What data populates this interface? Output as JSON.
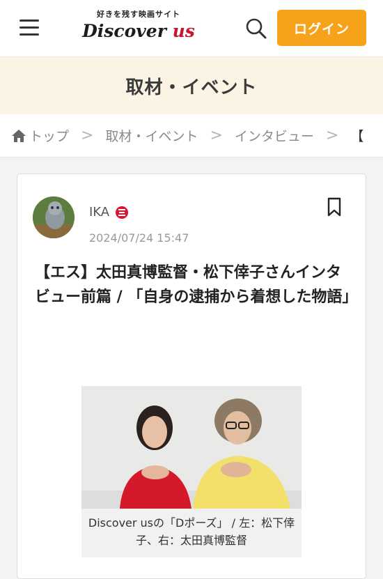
{
  "header": {
    "tagline": "好きを残す映画サイト",
    "logo_main": "Discover ",
    "logo_accent": "us",
    "login_label": "ログイン"
  },
  "banner": {
    "title": "取材・イベント"
  },
  "breadcrumb": {
    "items": [
      "トップ",
      "取材・イベント",
      "インタビュー",
      "【"
    ],
    "separator": ">"
  },
  "article": {
    "author": "IKA",
    "date": "2024/07/24 15:47",
    "title": "【エス】太田真博監督・松下倖子さんインタビュー前篇 / 「自身の逮捕から着想した物語」",
    "caption": "Discover usの「Dポーズ」 / 左：松下倖子、右：太田真博監督"
  },
  "colors": {
    "accent": "#f7a21b",
    "banner_bg": "#fbf3e3",
    "logo_red": "#c9142e"
  },
  "icons": {
    "menu": "hamburger-menu-icon",
    "search": "search-icon",
    "home": "home-icon",
    "bookmark": "bookmark-icon",
    "badge": "author-badge-icon"
  }
}
